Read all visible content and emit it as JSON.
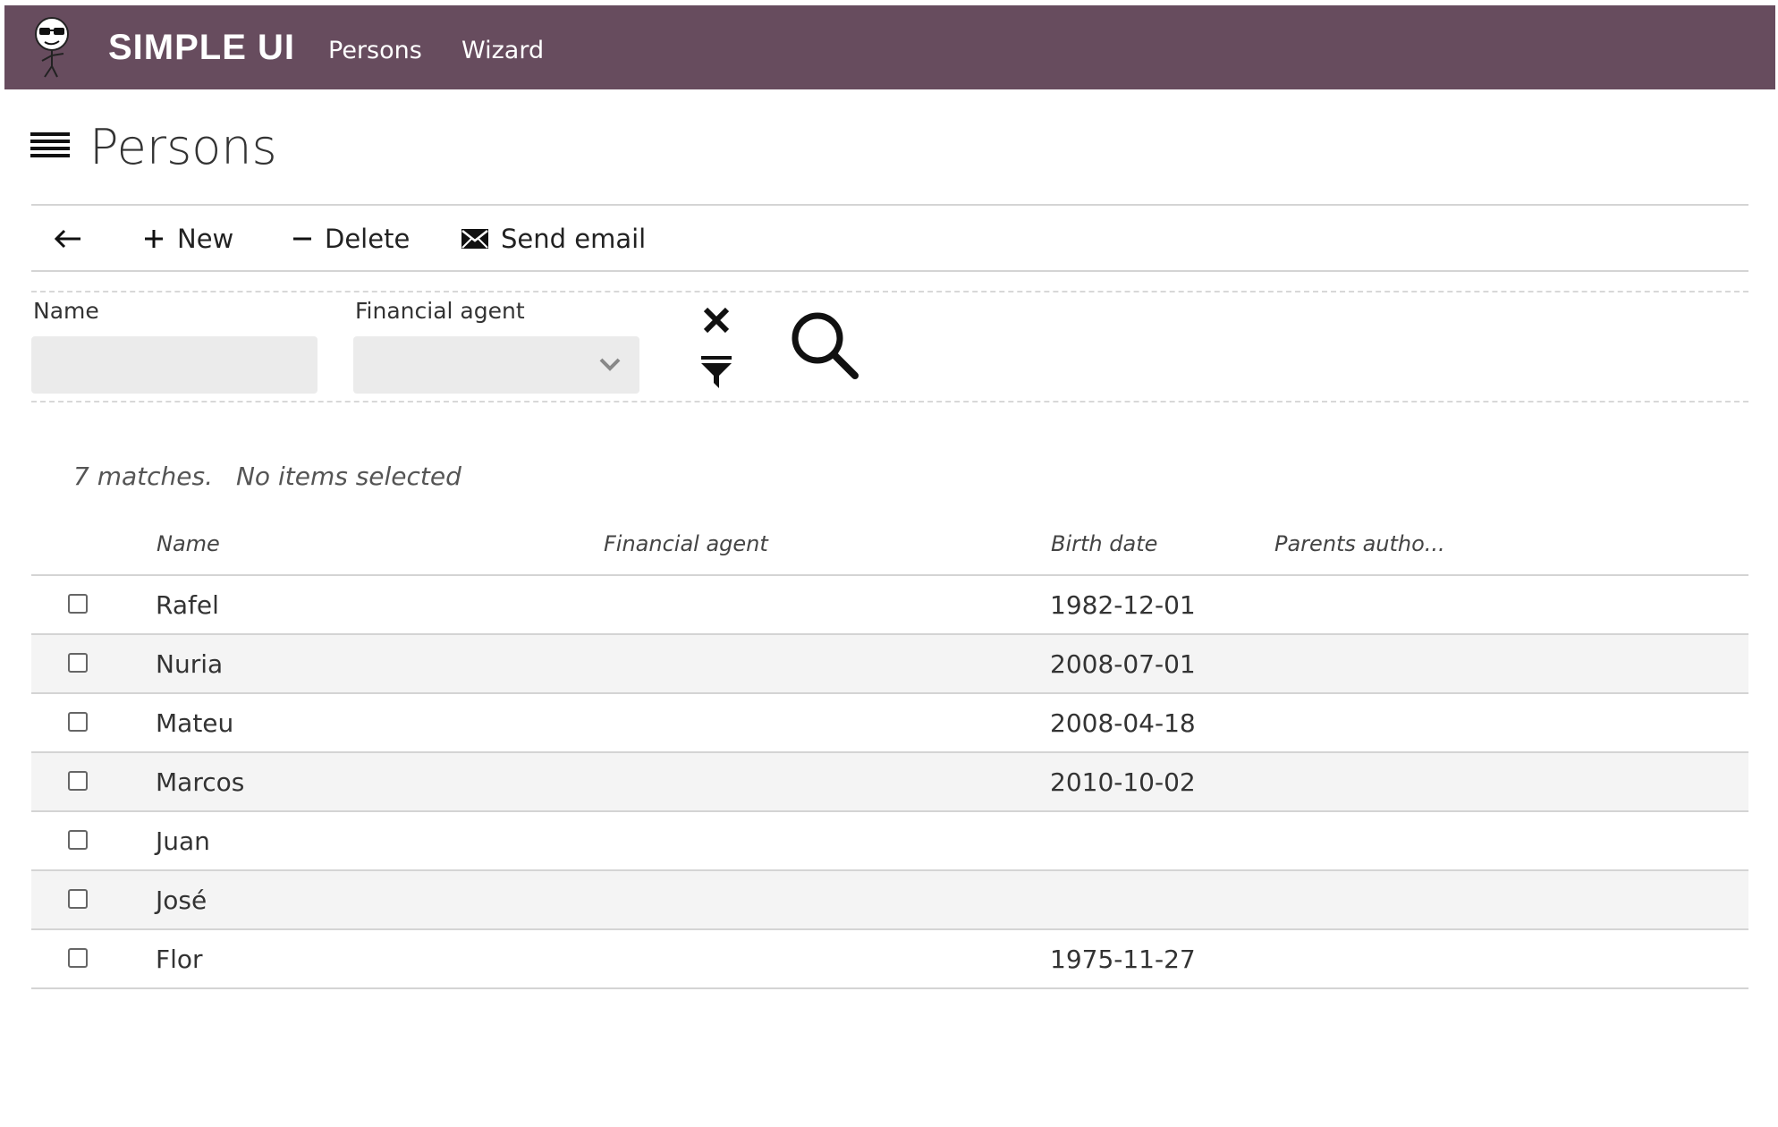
{
  "header": {
    "brand": "SIMPLE UI",
    "nav": [
      "Persons",
      "Wizard"
    ],
    "accent_color": "#674c5e"
  },
  "page": {
    "title": "Persons",
    "menu_icon": "hamburger-menu-icon"
  },
  "toolbar": {
    "back_icon": "arrow-left-icon",
    "new_label": "New",
    "delete_label": "Delete",
    "send_email_label": "Send email"
  },
  "filters": {
    "name_label": "Name",
    "name_value": "",
    "agent_label": "Financial agent",
    "agent_value": "",
    "clear_icon": "close-icon",
    "filter_icon": "filter-icon",
    "search_icon": "search-icon"
  },
  "results": {
    "matches": "7 matches.",
    "selection": "No items selected"
  },
  "table": {
    "columns": [
      "Name",
      "Financial agent",
      "Birth date",
      "Parents autho..."
    ],
    "rows": [
      {
        "name": "Rafel",
        "agent": "",
        "birth": "1982-12-01",
        "parents": ""
      },
      {
        "name": "Nuria",
        "agent": "",
        "birth": "2008-07-01",
        "parents": ""
      },
      {
        "name": "Mateu",
        "agent": "",
        "birth": "2008-04-18",
        "parents": ""
      },
      {
        "name": "Marcos",
        "agent": "",
        "birth": "2010-10-02",
        "parents": ""
      },
      {
        "name": "Juan",
        "agent": "",
        "birth": "",
        "parents": ""
      },
      {
        "name": "José",
        "agent": "",
        "birth": "",
        "parents": ""
      },
      {
        "name": "Flor",
        "agent": "",
        "birth": "1975-11-27",
        "parents": ""
      }
    ]
  }
}
